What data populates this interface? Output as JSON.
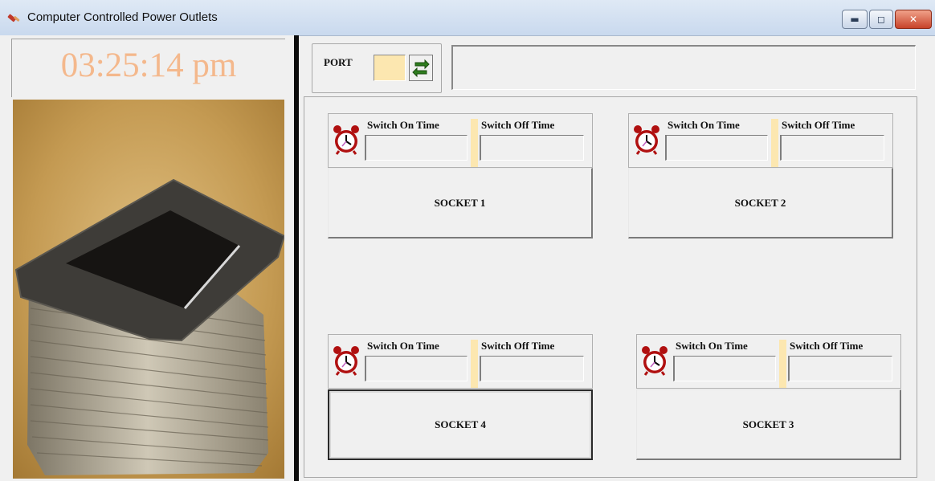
{
  "window": {
    "title": "Computer Controlled Power Outlets",
    "buttons": {
      "minimize": "▬",
      "maximize": "◻",
      "close": "✕"
    }
  },
  "clock": {
    "time": "03:25:14 pm",
    "color": "#f4b88c"
  },
  "photo": {
    "description_icon": "slide-stack-photo"
  },
  "port": {
    "label": "PORT",
    "value": "",
    "refresh_icon": "refresh-arrows-icon"
  },
  "status": {
    "text": ""
  },
  "sockets": [
    {
      "switch_on_label": "Switch On Time",
      "switch_off_label": "Switch Off Time",
      "switch_on_value": "",
      "switch_off_value": "",
      "button": "SOCKET 1"
    },
    {
      "switch_on_label": "Switch On Time",
      "switch_off_label": "Switch Off Time",
      "switch_on_value": "",
      "switch_off_value": "",
      "button": "SOCKET 2"
    },
    {
      "switch_on_label": "Switch On Time",
      "switch_off_label": "Switch Off Time",
      "switch_on_value": "",
      "switch_off_value": "",
      "button": "SOCKET 4"
    },
    {
      "switch_on_label": "Switch On Time",
      "switch_off_label": "Switch Off Time",
      "switch_on_value": "",
      "switch_off_value": "",
      "button": "SOCKET 3"
    }
  ],
  "colors": {
    "accent_field": "#fce7b0",
    "divider": "#0c0c0c",
    "alarm_clock": "#b01010"
  }
}
